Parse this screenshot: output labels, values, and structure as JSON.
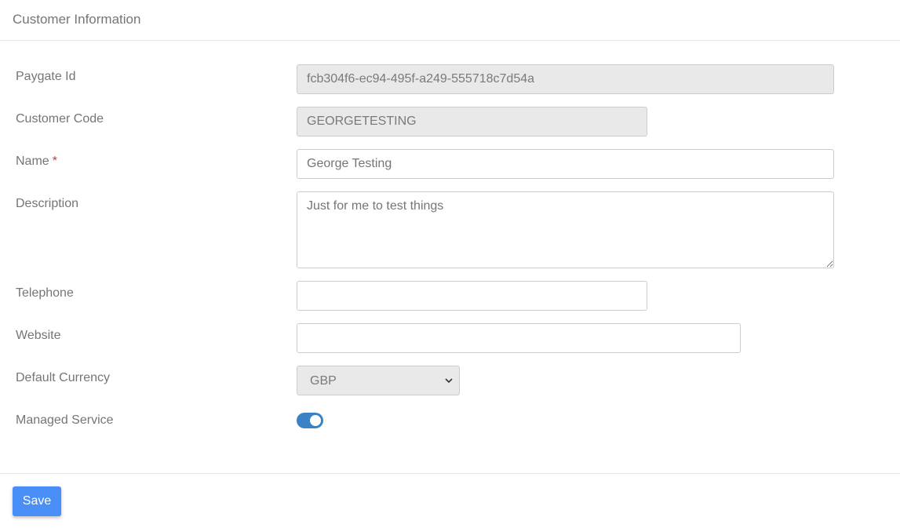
{
  "card": {
    "title": "Customer Information"
  },
  "fields": {
    "paygate_id": {
      "label": "Paygate Id",
      "value": "fcb304f6-ec94-495f-a249-555718c7d54a"
    },
    "customer_code": {
      "label": "Customer Code",
      "value": "GEORGETESTING"
    },
    "name": {
      "label": "Name",
      "required_marker": "*",
      "value": "George Testing"
    },
    "description": {
      "label": "Description",
      "value": "Just for me to test things"
    },
    "telephone": {
      "label": "Telephone",
      "value": ""
    },
    "website": {
      "label": "Website",
      "value": ""
    },
    "default_currency": {
      "label": "Default Currency",
      "selected": "GBP"
    },
    "managed_service": {
      "label": "Managed Service",
      "checked": true
    }
  },
  "actions": {
    "save_label": "Save"
  },
  "colors": {
    "accent": "#4a8ef7",
    "toggle_on": "#3b82c4",
    "required": "#d9302c",
    "readonly_bg": "#e9e9e9"
  },
  "icons": {
    "select": "chevron-down-icon",
    "textarea": "resize-grip-icon"
  }
}
